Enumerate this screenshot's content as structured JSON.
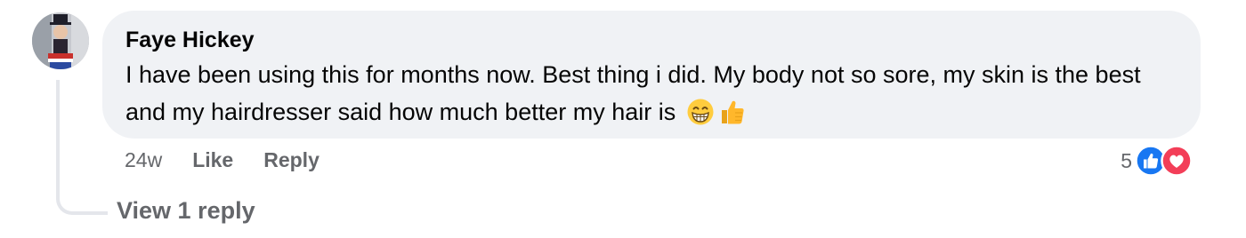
{
  "comment": {
    "author": "Faye Hickey",
    "text": "I have been using this for months now. Best thing i did. My body not so sore, my skin is the best and my hairdresser said how much better my hair is",
    "emojis": [
      "grinning-face-with-smiling-eyes",
      "thumbs-up"
    ],
    "timestamp": "24w",
    "like_label": "Like",
    "reply_label": "Reply",
    "reaction_count": "5",
    "reaction_types": [
      "like",
      "love"
    ],
    "view_replies_label": "View 1 reply"
  },
  "colors": {
    "bubble": "#f0f2f5",
    "text": "#050505",
    "secondary": "#65676b",
    "like_blue": "#1877f2",
    "love_red": "#f33e58",
    "thread_line": "#e4e6eb"
  }
}
